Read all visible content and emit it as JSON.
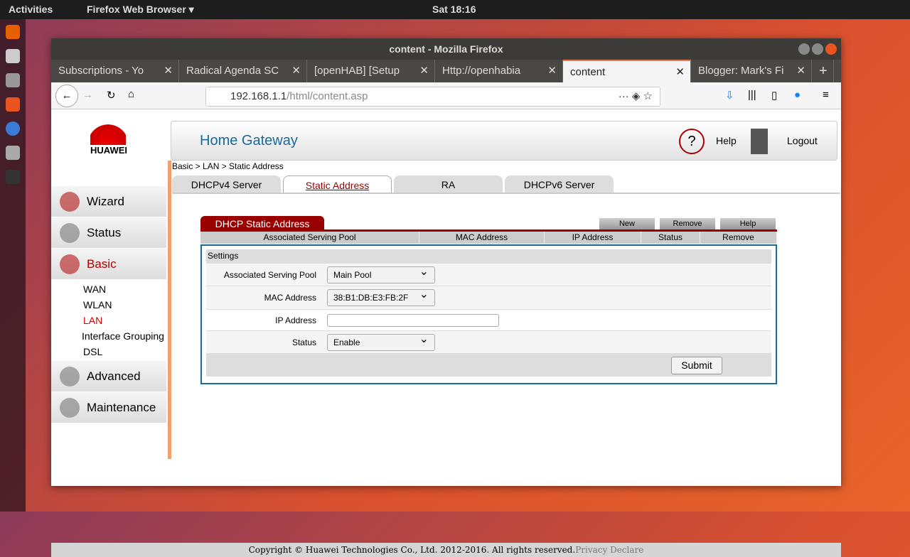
{
  "topbar": {
    "activities": "Activities",
    "app": "Firefox Web Browser ▾",
    "clock": "Sat 18:16"
  },
  "window": {
    "title": "content - Mozilla Firefox"
  },
  "tabs": [
    {
      "label": "Subscriptions - Yo"
    },
    {
      "label": "Radical Agenda SC"
    },
    {
      "label": "[openHAB] [Setup"
    },
    {
      "label": "Http://openhabia"
    },
    {
      "label": "content"
    },
    {
      "label": "Blogger: Mark's Fi"
    }
  ],
  "url": {
    "host": "192.168.1.1",
    "path": "/html/content.asp"
  },
  "header": {
    "title": "Home Gateway",
    "help": "Help",
    "logout": "Logout",
    "logo": "HUAWEI"
  },
  "sidebar": {
    "items": [
      {
        "label": "Wizard"
      },
      {
        "label": "Status"
      },
      {
        "label": "Basic"
      },
      {
        "label": "Advanced"
      },
      {
        "label": "Maintenance"
      }
    ],
    "sub": [
      "WAN",
      "WLAN",
      "LAN",
      "Interface Grouping",
      "DSL"
    ]
  },
  "breadcrumb": "Basic > LAN > Static Address",
  "page_tabs": [
    "DHCPv4 Server",
    "Static Address",
    "RA",
    "DHCPv6 Server"
  ],
  "dsa": {
    "title": "DHCP Static Address",
    "new": "New",
    "remove": "Remove",
    "help": "Help",
    "columns": [
      "Associated Serving Pool",
      "MAC Address",
      "IP Address",
      "Status",
      "Remove"
    ]
  },
  "settings": {
    "heading": "Settings",
    "pool_label": "Associated Serving Pool",
    "pool": "Main Pool",
    "mac_label": "MAC Address",
    "mac": "38:B1:DB:E3:FB:2F",
    "ip_label": "IP Address",
    "ip": "",
    "status_label": "Status",
    "status": "Enable",
    "submit": "Submit"
  },
  "footer": {
    "copyright": "Copyright © Huawei Technologies Co., Ltd. 2012-2016. All rights reserved.",
    "privacy": "Privacy Declare"
  }
}
